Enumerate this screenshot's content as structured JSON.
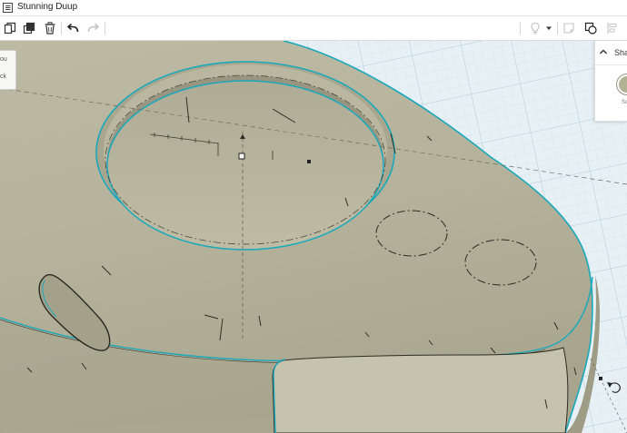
{
  "app": {
    "title": "Stunning Duup",
    "menu_icon": "menu-icon"
  },
  "toolbar": {
    "left_icons": [
      "copy-icon",
      "duplicate-icon",
      "delete-icon",
      "undo-icon",
      "redo-icon"
    ],
    "right_icons": [
      "light-bulb-icon",
      "dropdown-icon",
      "note-icon",
      "group-icon",
      "align-icon"
    ]
  },
  "float_panel": {
    "line1": "ou",
    "line2": "ck"
  },
  "shape_panel": {
    "title": "Sha",
    "color_label": "So",
    "color": "#b3b295"
  },
  "colors": {
    "model": "#b4b299",
    "outline": "#1aa8bb",
    "grid": "#c9dde8",
    "workplane": "#e6eff5"
  }
}
